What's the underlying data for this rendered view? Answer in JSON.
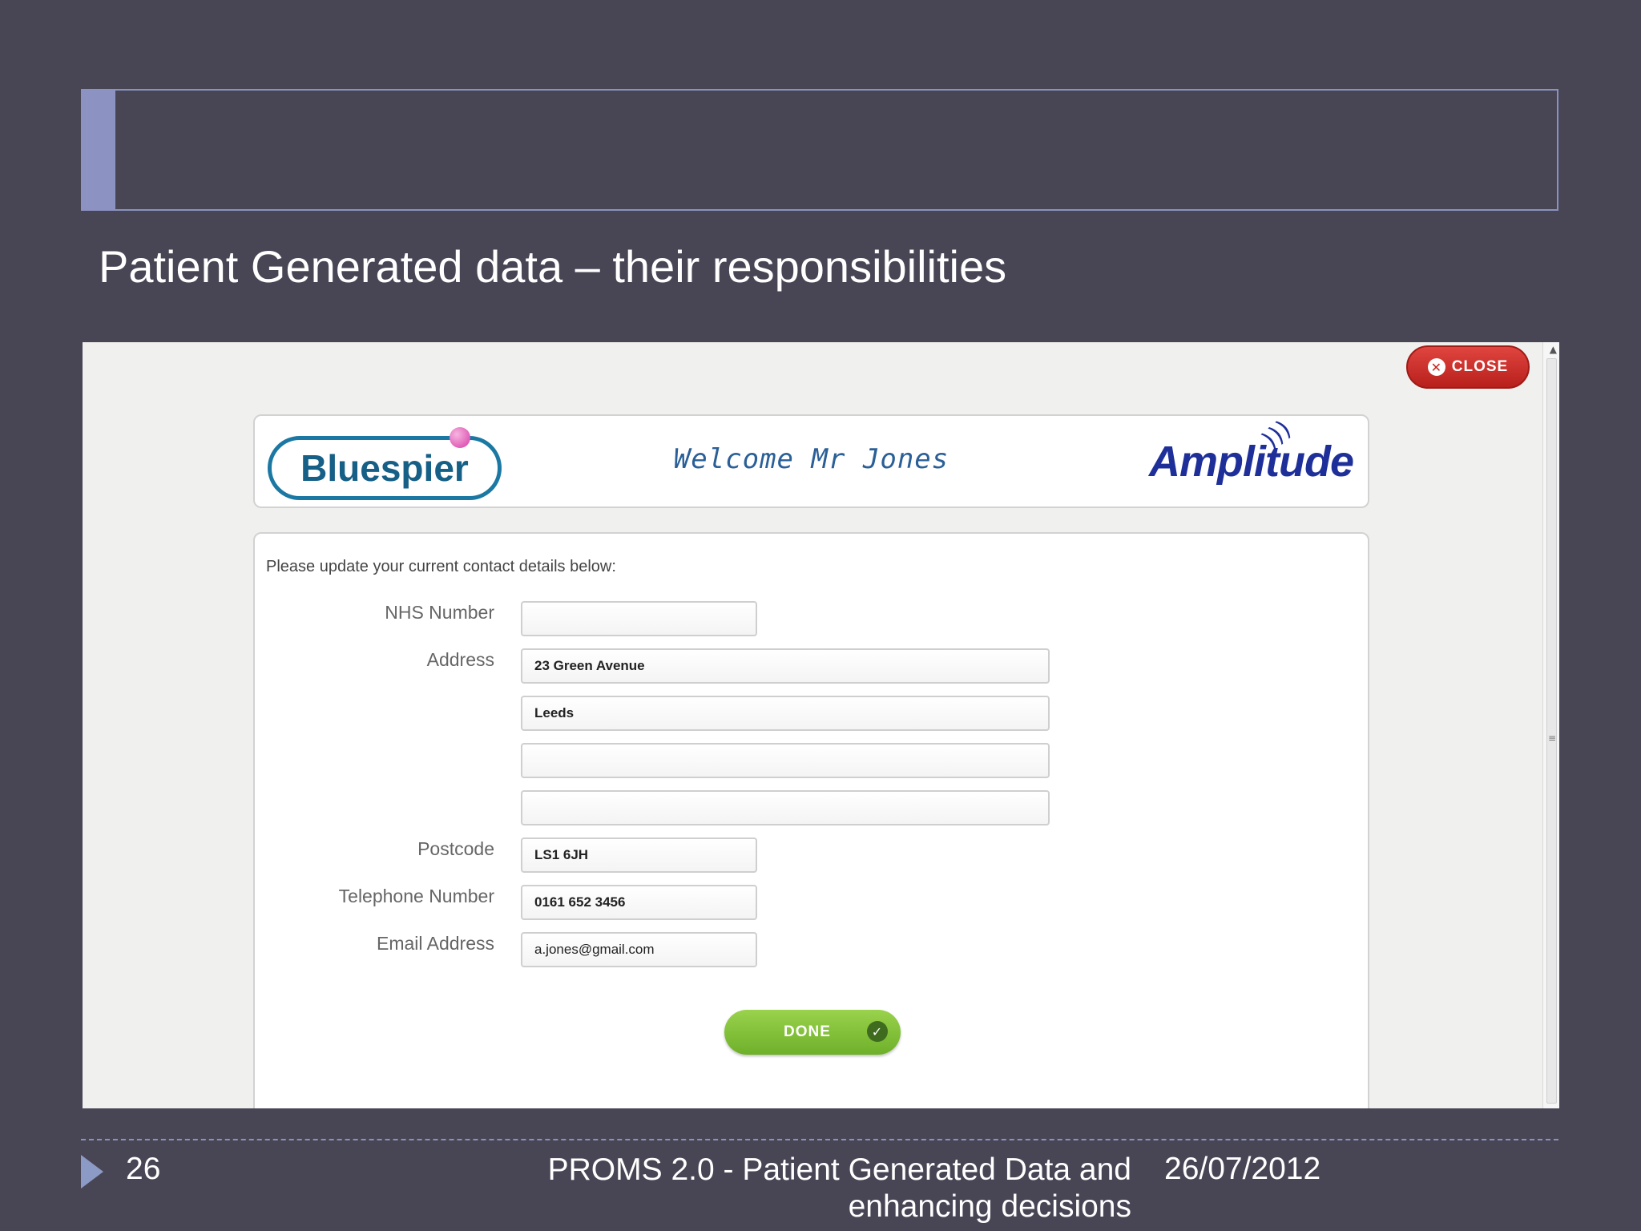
{
  "slide": {
    "title": "Patient Generated data – their responsibilities",
    "footer": {
      "page_number": "26",
      "title_line1": "PROMS 2.0 - Patient Generated Data and",
      "title_line2": "enhancing decisions",
      "date": "26/07/2012"
    }
  },
  "app": {
    "close_label": "CLOSE",
    "banner": {
      "left_logo_text": "Bluespier",
      "welcome": "Welcome Mr Jones",
      "right_logo_text": "Amplitude"
    },
    "form": {
      "instructions": "Please update your current contact details below:",
      "labels": {
        "nhs_number": "NHS Number",
        "address": "Address",
        "postcode": "Postcode",
        "telephone": "Telephone Number",
        "email": "Email Address"
      },
      "values": {
        "nhs_number": "",
        "address_line1": "23 Green Avenue",
        "address_line2": "Leeds",
        "address_line3": "",
        "address_line4": "",
        "postcode": "LS1 6JH",
        "telephone": "0161 652 3456",
        "email": "a.jones@gmail.com"
      },
      "done_label": "DONE"
    }
  },
  "colors": {
    "slide_background": "#484655",
    "accent": "#8c93c2",
    "close_button": "#c8271f",
    "done_button": "#7cbd33",
    "bluespier": "#1b78a3",
    "amplitude": "#1e2f9a"
  },
  "icons": {
    "close": "x-circle-icon",
    "done": "check-circle-icon",
    "footer_bullet": "triangle-right-icon"
  }
}
